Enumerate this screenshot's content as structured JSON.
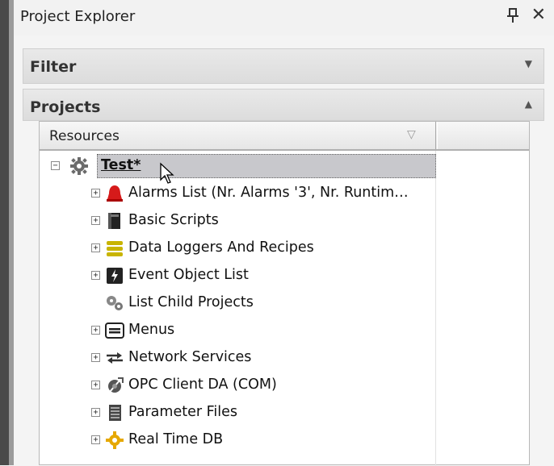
{
  "window": {
    "title": "Project Explorer",
    "pin_glyph": "ᵰ",
    "close_glyph": "✕"
  },
  "filter_section": {
    "label": "Filter",
    "arrow": "▼"
  },
  "projects_section": {
    "label": "Projects",
    "arrow": "▲"
  },
  "tree": {
    "column_header": "Resources",
    "sort_glyph": "▽",
    "root": {
      "label": "Test*",
      "icon": "gear-icon",
      "expander": "−"
    },
    "items": [
      {
        "label": "Alarms List (Nr. Alarms '3', Nr. Runtim…",
        "icon": "alarm-bell-icon",
        "expander": "+",
        "has_expander": true
      },
      {
        "label": "Basic Scripts",
        "icon": "script-icon",
        "expander": "+",
        "has_expander": true
      },
      {
        "label": "Data Loggers And Recipes",
        "icon": "database-icon",
        "expander": "+",
        "has_expander": true
      },
      {
        "label": "Event Object List",
        "icon": "event-icon",
        "expander": "+",
        "has_expander": true
      },
      {
        "label": "List Child Projects",
        "icon": "gears-icon",
        "expander": "",
        "has_expander": false
      },
      {
        "label": "Menus",
        "icon": "menu-icon",
        "expander": "+",
        "has_expander": true
      },
      {
        "label": "Network Services",
        "icon": "network-arrows-icon",
        "expander": "+",
        "has_expander": true
      },
      {
        "label": "OPC Client DA (COM)",
        "icon": "opc-client-icon",
        "expander": "+",
        "has_expander": true
      },
      {
        "label": "Parameter Files",
        "icon": "parameter-file-icon",
        "expander": "+",
        "has_expander": true
      },
      {
        "label": "Real Time DB",
        "icon": "realtime-db-icon",
        "expander": "+",
        "has_expander": true
      }
    ]
  },
  "colors": {
    "selection": "#c8c8cc",
    "alarm": "#d61a1a",
    "database": "#c8b400",
    "realtime": "#e6a800"
  }
}
